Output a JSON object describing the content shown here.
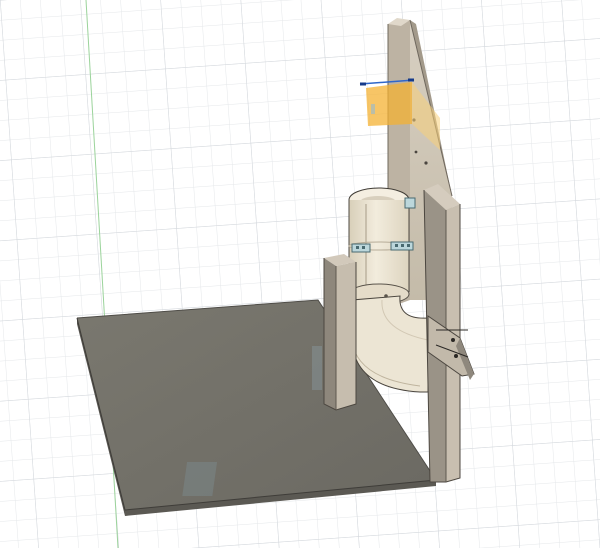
{
  "viewport": {
    "view": "3D model canvas",
    "background_color": "#ffffff",
    "grid_color": "#d7dbe0",
    "axis_color": "#9bd39b"
  },
  "model": {
    "base_plate_color": "#74726b",
    "upright_color": "#cdc4b6",
    "side_dark_color": "#8e877c",
    "drum_color": "#e9e1cd",
    "highlight_color": "#f4b233",
    "selection_color": "#2f66c9"
  }
}
